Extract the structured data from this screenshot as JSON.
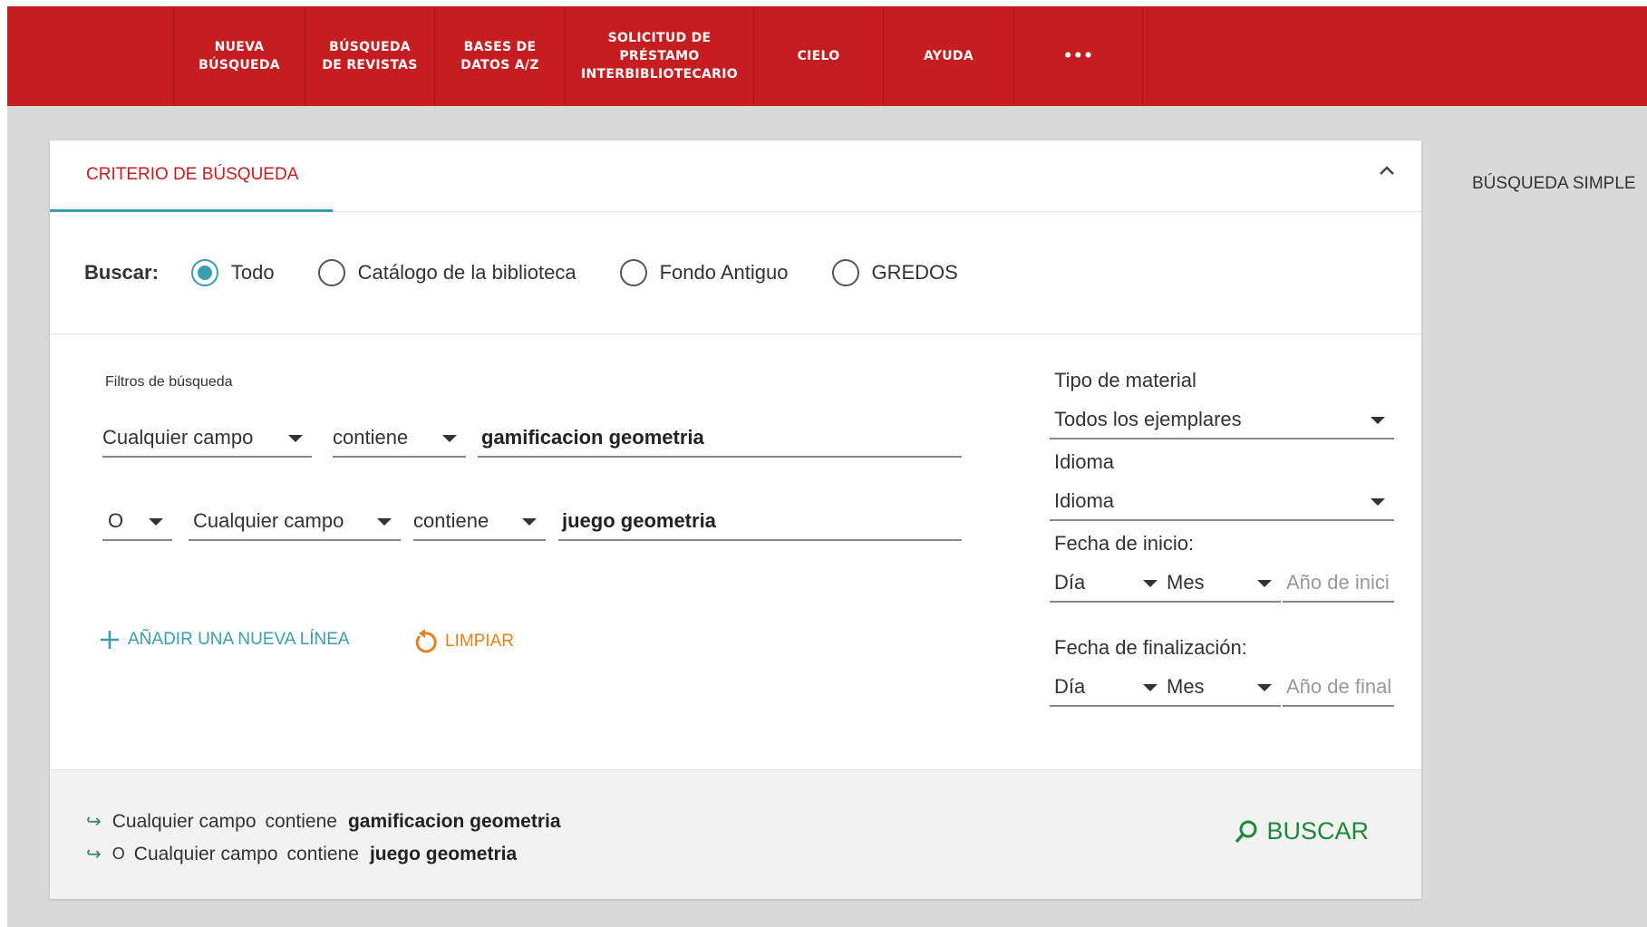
{
  "nav": {
    "items": [
      {
        "label": "NUEVA\nBÚSQUEDA"
      },
      {
        "label": "BÚSQUEDA\nDE REVISTAS"
      },
      {
        "label": "BASES DE\nDATOS A/Z"
      },
      {
        "label": "SOLICITUD DE\nPRÉSTAMO\nINTERBIBLIOTECARIO"
      },
      {
        "label": "CIELO"
      },
      {
        "label": "AYUDA"
      },
      {
        "label": "•••"
      }
    ]
  },
  "panel": {
    "tab_title": "CRITERIO DE BÚSQUEDA",
    "scope_label": "Buscar:",
    "scopes": [
      {
        "label": "Todo",
        "checked": true
      },
      {
        "label": "Catálogo de la biblioteca",
        "checked": false
      },
      {
        "label": "Fondo Antiguo",
        "checked": false
      },
      {
        "label": "GREDOS",
        "checked": false
      }
    ],
    "filters_label": "Filtros de búsqueda",
    "row1": {
      "field": "Cualquier campo",
      "operator": "contiene",
      "value": "gamificacion geometria"
    },
    "row2": {
      "boolean": "O",
      "field": "Cualquier campo",
      "operator": "contiene",
      "value": "juego geometria"
    },
    "add_line": "AÑADIR UNA NUEVA LÍNEA",
    "clear": "LIMPIAR",
    "material_type_label": "Tipo de material",
    "material_type_value": "Todos los ejemplares",
    "language_label": "Idioma",
    "language_value": "Idioma",
    "start_date_label": "Fecha de inicio:",
    "start_day": "Día",
    "start_month": "Mes",
    "start_year_placeholder": "Año de inici",
    "end_date_label": "Fecha de finalización:",
    "end_day": "Día",
    "end_month": "Mes",
    "end_year_placeholder": "Año de final"
  },
  "summary": {
    "line1": {
      "field": "Cualquier campo",
      "operator": "contiene",
      "value": "gamificacion geometria"
    },
    "line2": {
      "boolean": "O",
      "field": "Cualquier campo",
      "operator": "contiene",
      "value": "juego geometria"
    },
    "search_label": "BUSCAR"
  },
  "right_link": "BÚSQUEDA SIMPLE",
  "colors": {
    "brand_red": "#c51d20",
    "accent_teal": "#3a9db0",
    "clear_orange": "#e6821e",
    "search_green": "#1d8a3a"
  }
}
